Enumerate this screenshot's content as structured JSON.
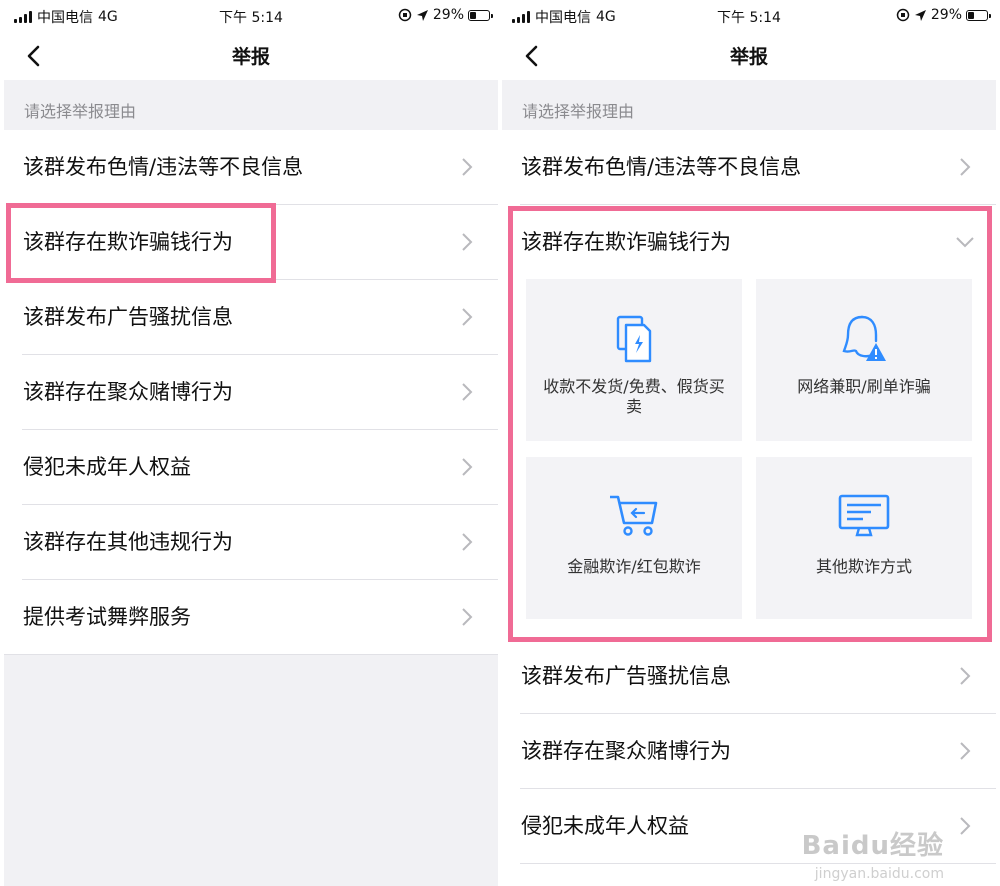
{
  "status_left": {
    "carrier": "中国电信",
    "network": "4G",
    "time": "下午 5:14",
    "battery": "29%"
  },
  "status_right": {
    "carrier": "中国电信",
    "network": "4G",
    "time": "下午 5:14",
    "battery": "29%"
  },
  "nav": {
    "title": "举报"
  },
  "section_header": "请选择举报理由",
  "left_list": [
    "该群发布色情/违法等不良信息",
    "该群存在欺诈骗钱行为",
    "该群发布广告骚扰信息",
    "该群存在聚众赌博行为",
    "侵犯未成年人权益",
    "该群存在其他违规行为",
    "提供考试舞弊服务"
  ],
  "right_list": {
    "first": "该群发布色情/违法等不良信息",
    "expanded_title": "该群存在欺诈骗钱行为",
    "cards": [
      {
        "label": "收款不发货/免费、假货买卖",
        "icon": "document-lightning-icon"
      },
      {
        "label": "网络兼职/刷单诈骗",
        "icon": "person-warning-icon"
      },
      {
        "label": "金融欺诈/红包欺诈",
        "icon": "shopping-cart-icon"
      },
      {
        "label": "其他欺诈方式",
        "icon": "monitor-icon"
      }
    ],
    "rest": [
      "该群发布广告骚扰信息",
      "该群存在聚众赌博行为",
      "侵犯未成年人权益"
    ]
  },
  "watermark": {
    "logo": "Baidu经验",
    "url": "jingyan.baidu.com"
  },
  "colors": {
    "accent_blue": "#2f8cff",
    "highlight": "#f06b95",
    "separator": "#e1e1e6",
    "band": "#f1f1f4"
  }
}
